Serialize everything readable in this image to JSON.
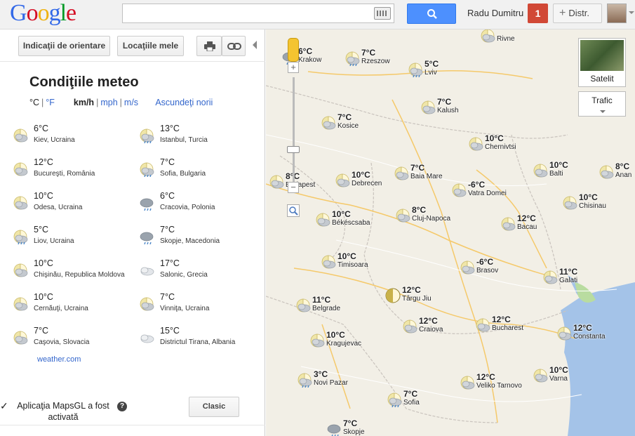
{
  "header": {
    "logo_letters": [
      {
        "ch": "G",
        "color": "#3369e8"
      },
      {
        "ch": "o",
        "color": "#d50f25"
      },
      {
        "ch": "o",
        "color": "#eeb211"
      },
      {
        "ch": "g",
        "color": "#3369e8"
      },
      {
        "ch": "l",
        "color": "#009925"
      },
      {
        "ch": "e",
        "color": "#d50f25"
      }
    ],
    "search_value": "",
    "username": "Radu Dumitru",
    "notification_count": "1",
    "share_plus": "+",
    "share_label": "Distr."
  },
  "toolbar": {
    "directions_label": "Indicaţii de orientare",
    "my_places_label": "Locaţiile mele"
  },
  "weather": {
    "title": "Condiţiile meteo",
    "unit_c": "°C",
    "unit_f": "°F",
    "unit_kmh": "km/h",
    "unit_mph": "mph",
    "unit_ms": "m/s",
    "unit_sep": "|",
    "hide_clouds": "Ascundeţi norii",
    "items": [
      {
        "temp": "6°C",
        "city": "Kiev, Ucraina",
        "icon": "partly-cloudy"
      },
      {
        "temp": "13°C",
        "city": "Istanbul, Turcia",
        "icon": "sun-rain"
      },
      {
        "temp": "12°C",
        "city": "Bucureşti, România",
        "icon": "partly-cloudy"
      },
      {
        "temp": "7°C",
        "city": "Sofia, Bulgaria",
        "icon": "sun-rain"
      },
      {
        "temp": "10°C",
        "city": "Odesa, Ucraina",
        "icon": "partly-cloudy"
      },
      {
        "temp": "6°C",
        "city": "Cracovia, Polonia",
        "icon": "rain"
      },
      {
        "temp": "5°C",
        "city": "Liov, Ucraina",
        "icon": "sun-rain"
      },
      {
        "temp": "7°C",
        "city": "Skopje, Macedonia",
        "icon": "rain"
      },
      {
        "temp": "10°C",
        "city": "Chişinău, Republica Moldova",
        "icon": "partly-cloudy"
      },
      {
        "temp": "17°C",
        "city": "Salonic, Grecia",
        "icon": "cloudy"
      },
      {
        "temp": "10°C",
        "city": "Cernăuţi, Ucraina",
        "icon": "partly-cloudy"
      },
      {
        "temp": "7°C",
        "city": "Vinniţa, Ucraina",
        "icon": "partly-cloudy"
      },
      {
        "temp": "7°C",
        "city": "Caşovia, Slovacia",
        "icon": "partly-cloudy"
      },
      {
        "temp": "15°C",
        "city": "Districtul Tirana, Albania",
        "icon": "cloudy"
      }
    ],
    "source_link": "weather.com"
  },
  "mapsgl": {
    "check": "✓",
    "message": "Aplicaţia MapsGL a fost activată",
    "help": "?",
    "classic_button": "Clasic"
  },
  "map_controls": {
    "zoom_in": "+",
    "zoom_out": "−",
    "zoom_out2": "−",
    "satellite_label": "Satelit",
    "traffic_label": "Trafic"
  },
  "map_markers": [
    {
      "temp": "",
      "city": "Rivne",
      "icon": "partly-cloudy"
    },
    {
      "temp": "6°C",
      "city": "Krakow",
      "icon": "rain"
    },
    {
      "temp": "7°C",
      "city": "Rzeszow",
      "icon": "sun-rain"
    },
    {
      "temp": "5°C",
      "city": "Lviv",
      "icon": "sun-rain"
    },
    {
      "temp": "7°C",
      "city": "Kalush",
      "icon": "partly-cloudy"
    },
    {
      "temp": "7°C",
      "city": "Kosice",
      "icon": "partly-cloudy"
    },
    {
      "temp": "10°C",
      "city": "Chernivtsi",
      "icon": "partly-cloudy"
    },
    {
      "temp": "10°C",
      "city": "Balti",
      "icon": "partly-cloudy"
    },
    {
      "temp": "8°C",
      "city": "Anan",
      "icon": "partly-cloudy"
    },
    {
      "temp": "8°C",
      "city": "Budapest",
      "icon": "partly-cloudy"
    },
    {
      "temp": "10°C",
      "city": "Debrecen",
      "icon": "partly-cloudy"
    },
    {
      "temp": "7°C",
      "city": "Baia Mare",
      "icon": "partly-cloudy"
    },
    {
      "temp": "-6°C",
      "city": "Vatra Domei",
      "icon": "partly-cloudy"
    },
    {
      "temp": "10°C",
      "city": "Chisinau",
      "icon": "partly-cloudy"
    },
    {
      "temp": "10°C",
      "city": "Békéscsaba",
      "icon": "partly-cloudy"
    },
    {
      "temp": "8°C",
      "city": "Cluj-Napoca",
      "icon": "partly-cloudy"
    },
    {
      "temp": "12°C",
      "city": "Bacau",
      "icon": "partly-cloudy"
    },
    {
      "temp": "10°C",
      "city": "Timisoara",
      "icon": "partly-cloudy"
    },
    {
      "temp": "-6°C",
      "city": "Brasov",
      "icon": "partly-cloudy"
    },
    {
      "temp": "11°C",
      "city": "Galati",
      "icon": "partly-cloudy"
    },
    {
      "temp": "12°C",
      "city": "Târgu Jiu",
      "icon": "half-moon"
    },
    {
      "temp": "11°C",
      "city": "Belgrade",
      "icon": "partly-cloudy"
    },
    {
      "temp": "12°C",
      "city": "Craiova",
      "icon": "partly-cloudy"
    },
    {
      "temp": "12°C",
      "city": "Bucharest",
      "icon": "partly-cloudy"
    },
    {
      "temp": "12°C",
      "city": "Constanta",
      "icon": "partly-cloudy"
    },
    {
      "temp": "10°C",
      "city": "Kragujevac",
      "icon": "partly-cloudy"
    },
    {
      "temp": "3°C",
      "city": "Novi Pazar",
      "icon": "sun-rain"
    },
    {
      "temp": "7°C",
      "city": "Sofia",
      "icon": "sun-rain"
    },
    {
      "temp": "12°C",
      "city": "Veliko Tarnovo",
      "icon": "partly-cloudy"
    },
    {
      "temp": "10°C",
      "city": "Varna",
      "icon": "partly-cloudy"
    },
    {
      "temp": "7°C",
      "city": "Skopje",
      "icon": "rain"
    }
  ],
  "colors": {
    "link": "#3366cc",
    "search_button": "#4d90fe",
    "notification": "#d14836",
    "sea": "#a4c3e8",
    "land": "#f2efe6",
    "road": "#f5c96a"
  }
}
